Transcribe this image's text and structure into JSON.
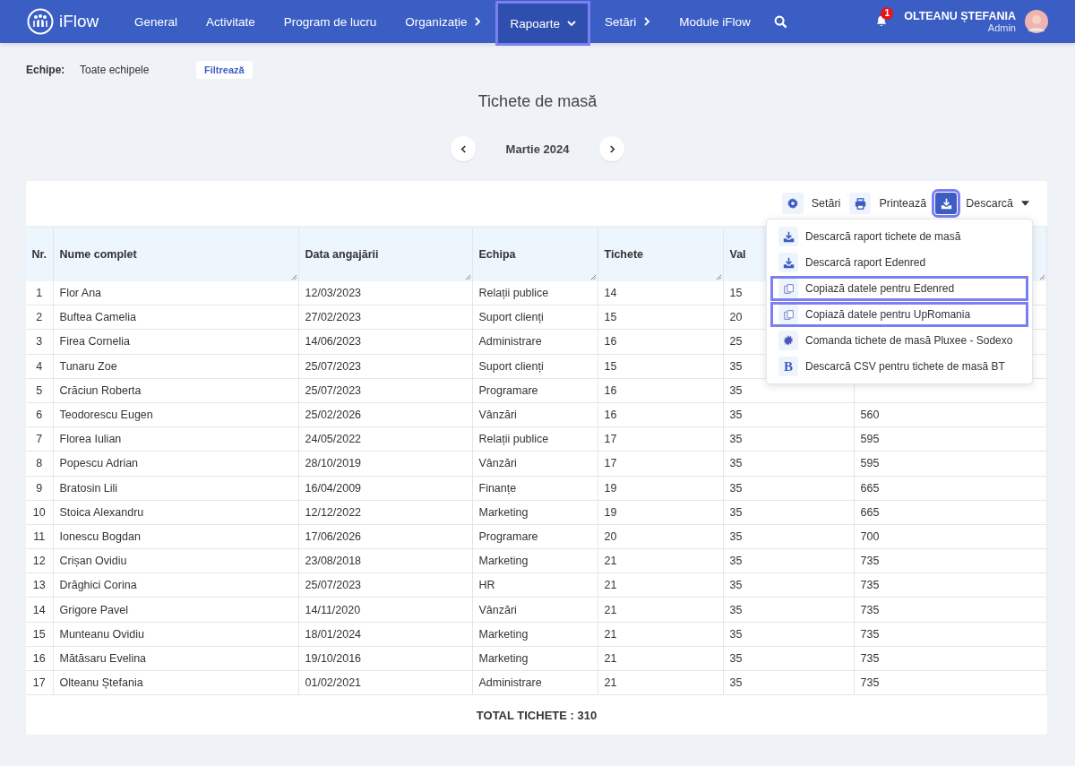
{
  "brand": "iFlow",
  "nav": [
    {
      "label": "General",
      "kind": "link",
      "highlighted": false
    },
    {
      "label": "Activitate",
      "kind": "link",
      "highlighted": false
    },
    {
      "label": "Program de lucru",
      "kind": "link",
      "highlighted": false
    },
    {
      "label": "Organizație",
      "kind": "submenu",
      "highlighted": false
    },
    {
      "label": "Rapoarte",
      "kind": "dropdown",
      "highlighted": true
    },
    {
      "label": "Setări",
      "kind": "submenu",
      "highlighted": false
    },
    {
      "label": "Module iFlow",
      "kind": "link",
      "highlighted": false
    }
  ],
  "notifications": "1",
  "user": {
    "name": "OLTEANU ȘTEFANIA",
    "role": "Admin"
  },
  "filter": {
    "label": "Echipe:",
    "value": "Toate echipele",
    "button": "Filtrează"
  },
  "title": "Tichete de masă",
  "period": "Martie 2024",
  "toolbar": {
    "settings": "Setări",
    "print": "Printează",
    "download": "Descarcă",
    "download_highlighted": true
  },
  "menu": [
    {
      "kind": "download",
      "label": "Descarcă raport tichete de masă",
      "highlighted": false
    },
    {
      "kind": "download",
      "label": "Descarcă raport Edenred",
      "highlighted": false
    },
    {
      "kind": "copy",
      "label": "Copiază datele pentru Edenred",
      "highlighted": true
    },
    {
      "kind": "copy",
      "label": "Copiază datele pentru UpRomania",
      "highlighted": true
    },
    {
      "kind": "burst",
      "label": "Comanda tichete de masă Pluxee - Sodexo",
      "highlighted": false
    },
    {
      "kind": "glyph",
      "glyph": "B",
      "label": "Descarcă CSV pentru tichete de masă BT",
      "highlighted": false
    }
  ],
  "table": {
    "columns": [
      "Nr.",
      "Nume complet",
      "Data angajării",
      "Echipa",
      "Tichete",
      "Val",
      null
    ],
    "rows": [
      [
        "1",
        "Flor Ana",
        "12/03/2023",
        "Relații publice",
        "14",
        "15",
        null
      ],
      [
        "2",
        "Buftea Camelia",
        "27/02/2023",
        "Suport clienți",
        "15",
        "20",
        null
      ],
      [
        "3",
        "Firea Cornelia",
        "14/06/2023",
        "Administrare",
        "16",
        "25",
        null
      ],
      [
        "4",
        "Tunaru Zoe",
        "25/07/2023",
        "Suport clienți",
        "15",
        "35",
        null
      ],
      [
        "5",
        "Crăciun Roberta",
        "25/07/2023",
        "Programare",
        "16",
        "35",
        null
      ],
      [
        "6",
        "Teodorescu Eugen",
        "25/02/2026",
        "Vânzări",
        "16",
        "35",
        "560"
      ],
      [
        "7",
        "Florea Iulian",
        "24/05/2022",
        "Relații publice",
        "17",
        "35",
        "595"
      ],
      [
        "8",
        "Popescu Adrian",
        "28/10/2019",
        "Vânzări",
        "17",
        "35",
        "595"
      ],
      [
        "9",
        "Bratosin Lili",
        "16/04/2009",
        "Finanțe",
        "19",
        "35",
        "665"
      ],
      [
        "10",
        "Stoica Alexandru",
        "12/12/2022",
        "Marketing",
        "19",
        "35",
        "665"
      ],
      [
        "11",
        "Ionescu Bogdan",
        "17/06/2026",
        "Programare",
        "20",
        "35",
        "700"
      ],
      [
        "12",
        "Crișan Ovidiu",
        "23/08/2018",
        "Marketing",
        "21",
        "35",
        "735"
      ],
      [
        "13",
        "Drăghici Corina",
        "25/07/2023",
        "HR",
        "21",
        "35",
        "735"
      ],
      [
        "14",
        "Grigore Pavel",
        "14/11/2020",
        "Vânzări",
        "21",
        "35",
        "735"
      ],
      [
        "15",
        "Munteanu Ovidiu",
        "18/01/2024",
        "Marketing",
        "21",
        "35",
        "735"
      ],
      [
        "16",
        "Mătăsaru Evelina",
        "19/10/2016",
        "Marketing",
        "21",
        "35",
        "735"
      ],
      [
        "17",
        "Olteanu Ștefania",
        "01/02/2021",
        "Administrare",
        "21",
        "35",
        "735"
      ]
    ],
    "total": "TOTAL TICHETE : 310"
  }
}
